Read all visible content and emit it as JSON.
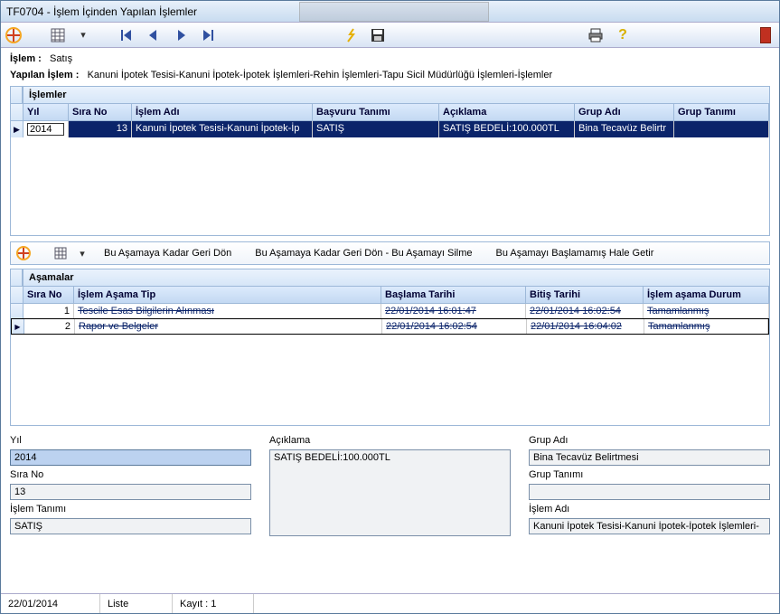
{
  "window": {
    "title": "TF0704 - İşlem İçinden Yapılan İşlemler"
  },
  "info": {
    "islem_label": "İşlem :",
    "islem_value": "Satış",
    "yapilan_label": "Yapılan İşlem :",
    "yapilan_value": "Kanuni İpotek Tesisi-Kanuni İpotek-İpotek İşlemleri-Rehin İşlemleri-Tapu Sicil Müdürlüğü İşlemleri-İşlemler"
  },
  "section1": {
    "title": "İşlemler"
  },
  "grid1": {
    "headers": [
      "Yıl",
      "Sıra No",
      "İşlem Adı",
      "Başvuru Tanımı",
      "Açıklama",
      "Grup Adı",
      "Grup Tanımı"
    ],
    "row": {
      "yil": "2014",
      "sira": "13",
      "islem_adi": "Kanuni İpotek Tesisi-Kanuni İpotek-İp",
      "basvuru": "SATIŞ",
      "aciklama": "SATIŞ BEDELİ:100.000TL",
      "grup_adi": "Bina Tecavüz Belirtr",
      "grup_tanimi": ""
    }
  },
  "toolbar2": {
    "btn1": "Bu Aşamaya Kadar Geri Dön",
    "btn2": "Bu Aşamaya Kadar Geri Dön - Bu Aşamayı Silme",
    "btn3": "Bu Aşamayı Başlamamış Hale Getir"
  },
  "section2": {
    "title": "Aşamalar"
  },
  "grid2": {
    "headers": [
      "Sıra No",
      "İşlem Aşama Tip",
      "Başlama Tarihi",
      "Bitiş Tarihi",
      "İşlem aşama Durum"
    ],
    "rows": [
      {
        "sira": "1",
        "tip": "Tescile Esas Bilgilerin Alınması",
        "baslama": "22/01/2014 16:01:47",
        "bitis": "22/01/2014 16:02:54",
        "durum": "Tamamlanmış"
      },
      {
        "sira": "2",
        "tip": "Rapor ve Belgeler",
        "baslama": "22/01/2014 16:02:54",
        "bitis": "22/01/2014 16:04:02",
        "durum": "Tamamlanmış"
      }
    ]
  },
  "form": {
    "yil_label": "Yıl",
    "yil_value": "2014",
    "sira_label": "Sıra No",
    "sira_value": "13",
    "islem_tanimi_label": "İşlem Tanımı",
    "islem_tanimi_value": "SATIŞ",
    "aciklama_label": "Açıklama",
    "aciklama_value": "SATIŞ BEDELİ:100.000TL",
    "grup_adi_label": "Grup Adı",
    "grup_adi_value": "Bina Tecavüz Belirtmesi",
    "grup_tanimi_label": "Grup Tanımı",
    "grup_tanimi_value": "",
    "islem_adi_label": "İşlem Adı",
    "islem_adi_value": "Kanuni İpotek Tesisi-Kanuni İpotek-İpotek İşlemleri-"
  },
  "status": {
    "date": "22/01/2014",
    "mode": "Liste",
    "kayit": "Kayıt : 1"
  }
}
